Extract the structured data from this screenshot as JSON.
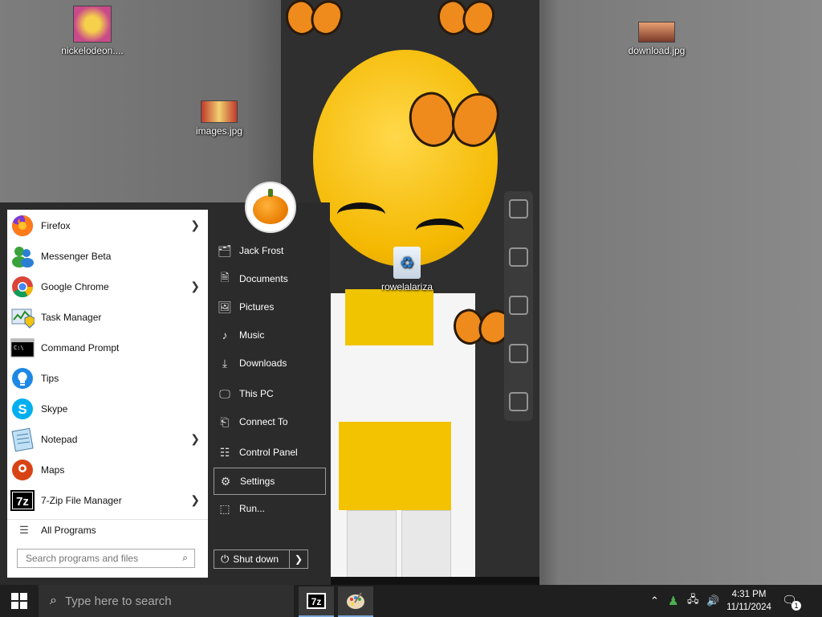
{
  "desktop": {
    "icons": [
      {
        "label": "nickelodeon...."
      },
      {
        "label": "images.jpg"
      },
      {
        "label": "download.jpg"
      },
      {
        "label": "rowelalariza"
      }
    ]
  },
  "start_menu": {
    "programs": [
      {
        "label": "Firefox",
        "icon": "firefox-icon",
        "has_submenu": true
      },
      {
        "label": "Messenger Beta",
        "icon": "messenger-icon",
        "has_submenu": false
      },
      {
        "label": "Google Chrome",
        "icon": "chrome-icon",
        "has_submenu": true
      },
      {
        "label": "Task Manager",
        "icon": "task-manager-icon",
        "has_submenu": false
      },
      {
        "label": "Command Prompt",
        "icon": "command-prompt-icon",
        "has_submenu": false
      },
      {
        "label": "Tips",
        "icon": "tips-icon",
        "has_submenu": false
      },
      {
        "label": "Skype",
        "icon": "skype-icon",
        "has_submenu": false
      },
      {
        "label": "Notepad",
        "icon": "notepad-icon",
        "has_submenu": true
      },
      {
        "label": "Maps",
        "icon": "maps-icon",
        "has_submenu": false
      },
      {
        "label": "7-Zip File Manager",
        "icon": "7zip-icon",
        "has_submenu": true
      }
    ],
    "all_programs": "All Programs",
    "search_placeholder": "Search programs and files",
    "places": [
      {
        "label": "Jack Frost",
        "icon": "user-folder-icon"
      },
      {
        "label": "Documents",
        "icon": "document-icon"
      },
      {
        "label": "Pictures",
        "icon": "picture-icon"
      },
      {
        "label": "Music",
        "icon": "music-icon"
      },
      {
        "label": "Downloads",
        "icon": "download-icon"
      },
      {
        "label": "This PC",
        "icon": "computer-icon"
      },
      {
        "label": "Connect To",
        "icon": "connect-icon"
      },
      {
        "label": "Control Panel",
        "icon": "control-panel-icon"
      },
      {
        "label": "Settings",
        "icon": "gear-icon"
      },
      {
        "label": "Run...",
        "icon": "run-icon"
      }
    ],
    "shutdown_label": "Shut down"
  },
  "taskbar": {
    "search_placeholder": "Type here to search",
    "clock_time": "4:31 PM",
    "clock_date": "11/11/2024",
    "notification_count": "1"
  }
}
